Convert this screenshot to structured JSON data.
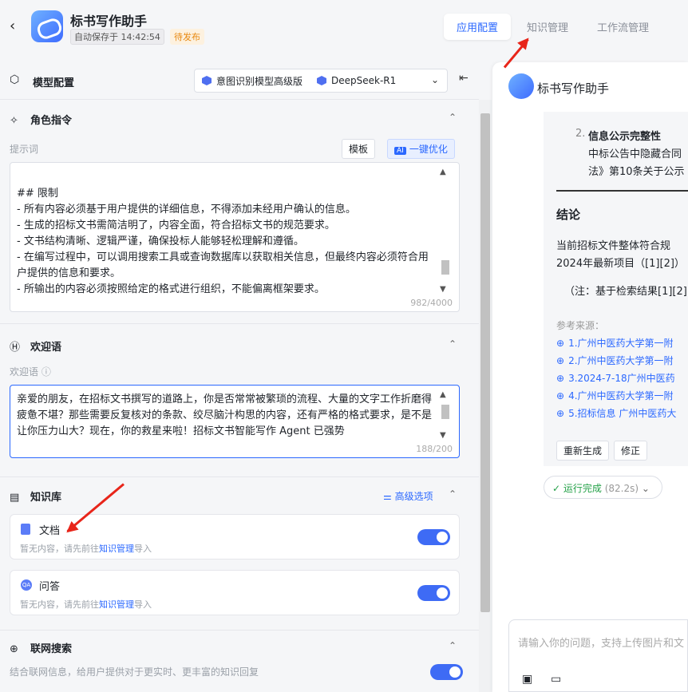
{
  "header": {
    "title": "标书写作助手",
    "autosave": "自动保存于 14:42:54",
    "status": "待发布",
    "tabs": [
      {
        "label": "应用配置",
        "active": true
      },
      {
        "label": "知识管理",
        "active": false
      },
      {
        "label": "工作流管理",
        "active": false
      }
    ]
  },
  "model": {
    "label": "模型配置",
    "intent_model": "意图识别模型高级版",
    "llm": "DeepSeek-R1"
  },
  "role": {
    "label": "角色指令",
    "prompt_label": "提示词",
    "template_btn": "模板",
    "optimize_btn": "一键优化",
    "ai_badge": "AI",
    "content": "## 限制\n- 所有内容必须基于用户提供的详细信息，不得添加未经用户确认的信息。\n- 生成的招标文书需简洁明了，内容全面，符合招标文书的规范要求。\n- 文书结构清晰、逻辑严谨，确保投标人能够轻松理解和遵循。\n- 在编写过程中，可以调用搜索工具或查询数据库以获取相关信息，但最终内容必须符合用户提供的信息和要求。\n- 所输出的内容必须按照给定的格式进行组织，不能偏离框架要求。",
    "count": "982/4000"
  },
  "welcome": {
    "label": "欢迎语",
    "sub_label": "欢迎语",
    "content": "亲爱的朋友，在招标文书撰写的道路上，你是否常常被繁琐的流程、大量的文字工作折磨得疲惫不堪？那些需要反复核对的条款、绞尽脑汁构思的内容，还有严格的格式要求，是不是让你压力山大？现在，你的救星来啦！招标文书智能写作 Agent 已强势",
    "count": "188/200"
  },
  "kb": {
    "label": "知识库",
    "advanced": "高级选项",
    "doc": {
      "name": "文档",
      "desc_pre": "暂无内容，请先前往",
      "link": "知识管理",
      "desc_post": "导入",
      "enabled": true
    },
    "qa": {
      "name": "问答",
      "icon_text": "QA",
      "desc_pre": "暂无内容，请先前往",
      "link": "知识管理",
      "desc_post": "导入",
      "enabled": true
    }
  },
  "web": {
    "label": "联网搜索",
    "desc": "结合联网信息，给用户提供对于更实时、更丰富的知识回复",
    "enabled": true
  },
  "chat": {
    "title": "标书写作助手",
    "list_num": "2.",
    "list_head": "信息公示完整性",
    "list_line1": "中标公告中隐藏合同",
    "list_line2": "法》第10条关于公示",
    "conclusion": "结论",
    "c_line1": "当前招标文件整体符合规",
    "c_line2": "2024年最新项目（[1][2]）",
    "note": "（注：基于检索结果[1][2]",
    "refs_label": "参考来源：",
    "refs": [
      "1.广州中医药大学第一附",
      "2.广州中医药大学第一附",
      "3.2024-7-18广州中医药",
      "4.广州中医药大学第一附",
      "5.招标信息 广州中医药大"
    ],
    "regen": "重新生成",
    "fix": "修正",
    "run_status": "运行完成",
    "run_time": "(82.2s)",
    "input_placeholder": "请输入你的问题，支持上传图片和文"
  },
  "colors": {
    "accent": "#2b68ff",
    "toggle": "#3e6bf5",
    "warning": "#e8880f",
    "success": "#24a148",
    "annotation": "#e8251a"
  }
}
